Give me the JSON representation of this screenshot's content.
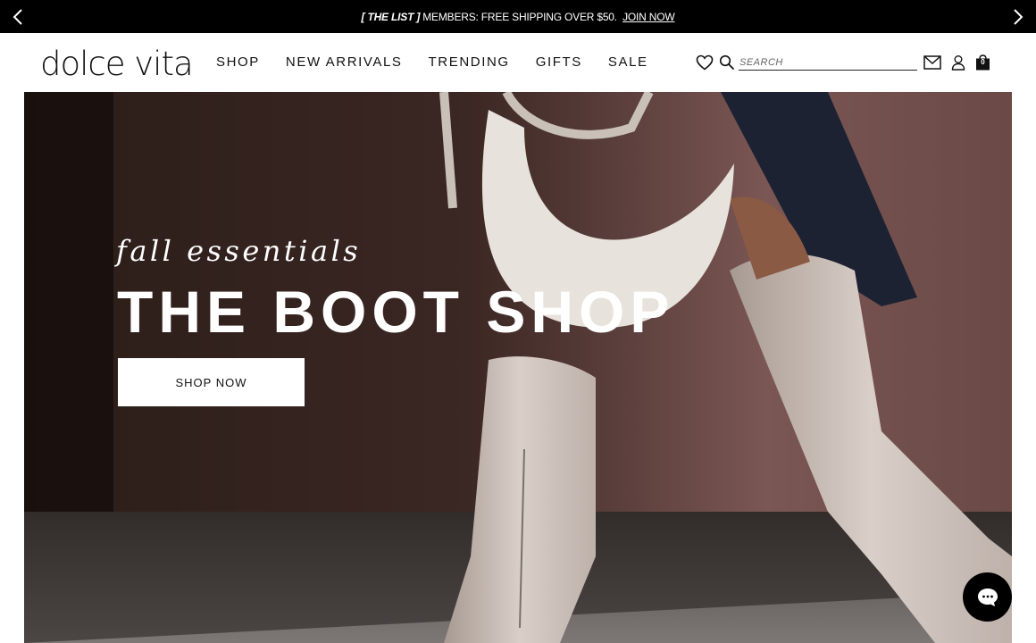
{
  "announcement": {
    "badge": "[ THE LIST ]",
    "message": " MEMBERS: FREE SHIPPING OVER $50.",
    "link": "JOIN NOW"
  },
  "header": {
    "logo": "dolce vita",
    "nav": [
      "SHOP",
      "NEW ARRIVALS",
      "TRENDING",
      "GIFTS",
      "SALE"
    ],
    "search_placeholder": "SEARCH",
    "cart_count": "0"
  },
  "hero": {
    "tagline": "fall essentials",
    "headline": "THE BOOT SHOP",
    "cta": "SHOP NOW"
  },
  "colors": {
    "bar": "#000000",
    "text": "#111111",
    "hero_text": "#ffffff"
  }
}
